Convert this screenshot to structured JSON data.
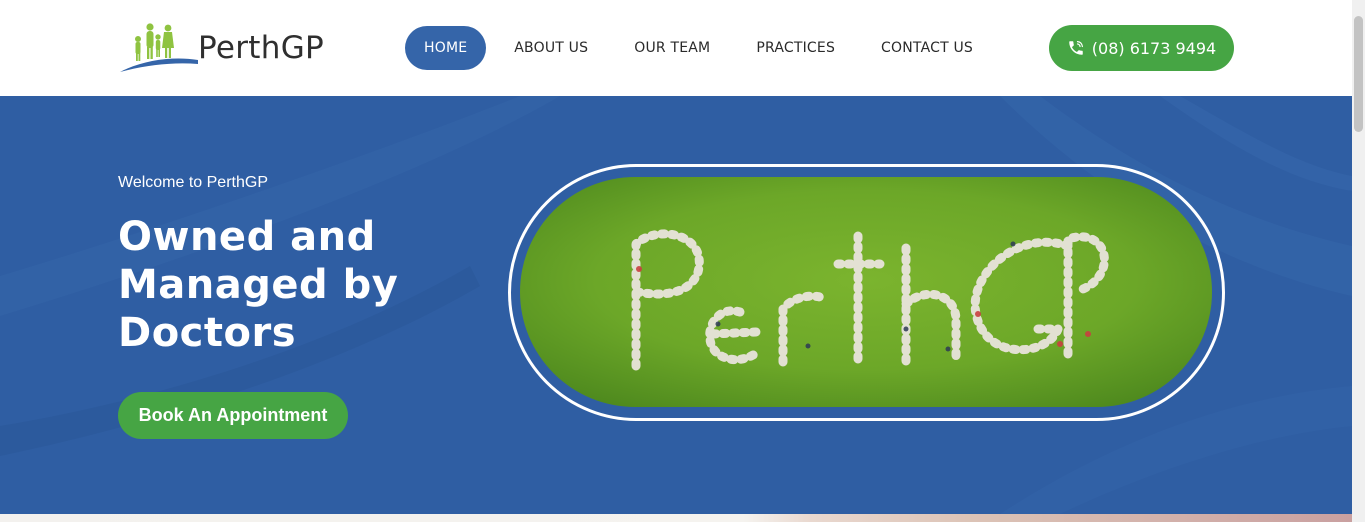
{
  "brand": {
    "name": "PerthGP",
    "logo_icon": "family-logo-icon"
  },
  "nav": {
    "items": [
      {
        "label": "HOME",
        "active": true
      },
      {
        "label": "ABOUT US",
        "active": false
      },
      {
        "label": "OUR TEAM",
        "active": false
      },
      {
        "label": "PRACTICES",
        "active": false
      },
      {
        "label": "CONTACT US",
        "active": false
      }
    ]
  },
  "phone": {
    "label": "(08) 6173 9494",
    "icon": "phone-icon"
  },
  "hero": {
    "welcome": "Welcome to PerthGP",
    "headline_lines": [
      "Owned and",
      "Managed by",
      "Doctors"
    ],
    "cta_label": "Book An Appointment",
    "image_description_icon": "aerial-people-spelling-perthgp-image"
  },
  "colors": {
    "primary_blue": "#2f5ea3",
    "nav_active_blue": "#3565a9",
    "accent_green": "#46a544",
    "grass_green": "#6ca728",
    "text_dark": "#2a2a2a"
  }
}
